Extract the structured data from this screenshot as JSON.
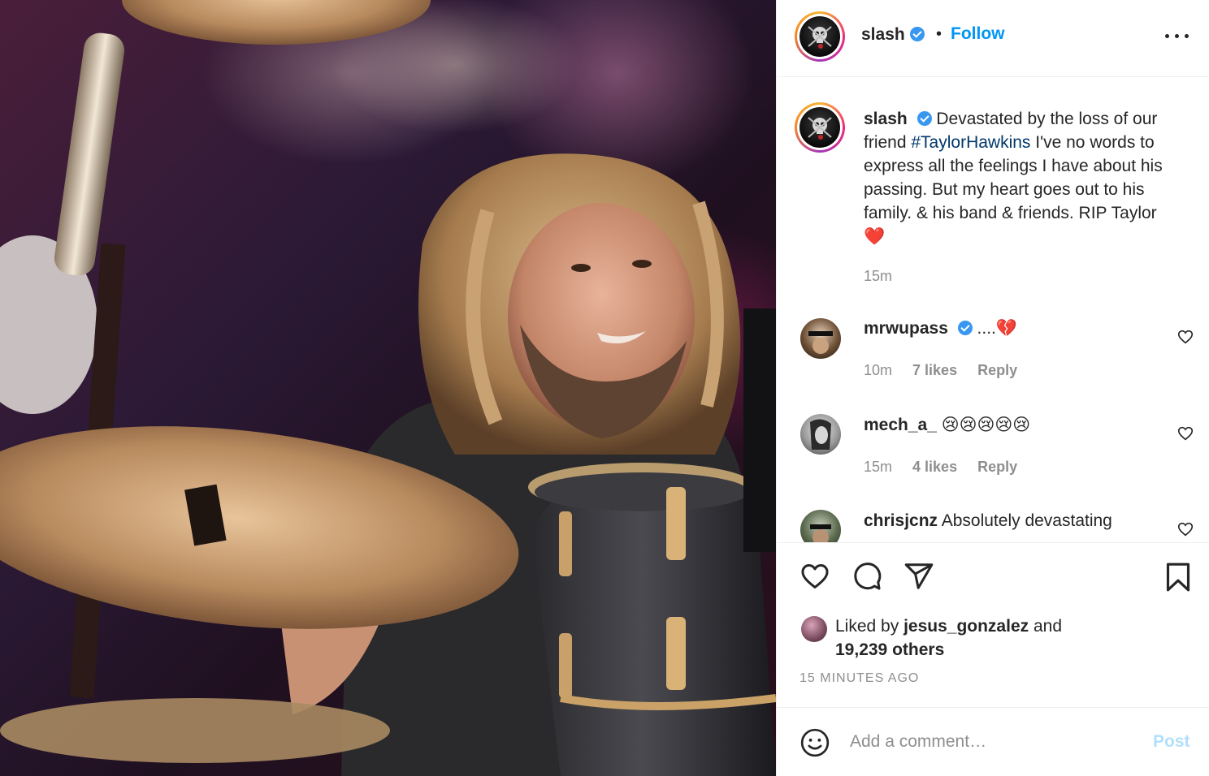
{
  "post": {
    "username": "slash",
    "follow_label": "Follow",
    "dot": "•",
    "photo_alt": "Taylor Hawkins drumming on stage"
  },
  "caption": {
    "username": "slash",
    "text_before": " Devastated by the loss of our friend ",
    "hashtag": "#TaylorHawkins",
    "text_after": " I've no words to express all the feelings I have about his passing. But my heart goes out to his family. & his band & friends. RIP Taylor",
    "emoji": "❤️",
    "time": "15m"
  },
  "comments": [
    {
      "username": "mrwupass",
      "verified": true,
      "text": " ....💔",
      "time": "10m",
      "likes": "7 likes",
      "reply": "Reply"
    },
    {
      "username": "mech_a_",
      "verified": false,
      "text": " 😢😢😢😢😢",
      "time": "15m",
      "likes": "4 likes",
      "reply": "Reply"
    },
    {
      "username": "chrisjcnz",
      "verified": false,
      "text": " Absolutely devastating"
    }
  ],
  "likes": {
    "prefix": "Liked by ",
    "user": "jesus_gonzalez",
    "middle": " and",
    "others": "19,239 others"
  },
  "timestamp": "15 MINUTES AGO",
  "comment_box": {
    "placeholder": "Add a comment…",
    "post_label": "Post"
  },
  "colors": {
    "follow": "#0095f6",
    "verified": "#3897f0",
    "hashtag": "#00376b",
    "muted": "#8e8e8e",
    "post_disabled": "#b2dffc",
    "heart_emoji": "#e8202a"
  }
}
